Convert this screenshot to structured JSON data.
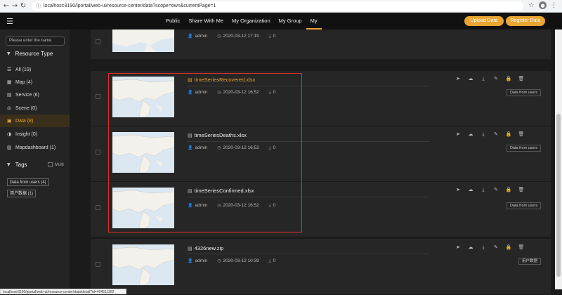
{
  "browser": {
    "url": "localhost:8190/iportal/web-ui/resource-center/data?scope=own&currentPage=1",
    "status_url": "localhost:8190/iportal/web-ui/resource-center/data/detail?id=404511392"
  },
  "topnav": {
    "tabs": [
      {
        "label": "Public"
      },
      {
        "label": "Share With Me"
      },
      {
        "label": "My Organization"
      },
      {
        "label": "My Group"
      },
      {
        "label": "My"
      }
    ],
    "upload_label": "Upload Data",
    "register_label": "Register Data"
  },
  "sidebar": {
    "search_placeholder": "Please enter the name",
    "resource_title": "Resource Type",
    "items": [
      {
        "label": "All (19)",
        "icon": "list-icon"
      },
      {
        "label": "Map (4)",
        "icon": "map-icon"
      },
      {
        "label": "Service (6)",
        "icon": "service-icon"
      },
      {
        "label": "Scene (0)",
        "icon": "scene-icon"
      },
      {
        "label": "Data (8)",
        "icon": "data-icon"
      },
      {
        "label": "Insight (0)",
        "icon": "insight-icon"
      },
      {
        "label": "Mapdashboard (1)",
        "icon": "dashboard-icon"
      }
    ],
    "tags_title": "Tags",
    "multi_label": "Multi",
    "tags": [
      {
        "label": "Data from users (4)"
      },
      {
        "label": "用户数据 (1)"
      }
    ]
  },
  "cards": [
    {
      "name": "",
      "user": "admin",
      "date": "2020-03-12 17:19",
      "downloads": "0",
      "tag": ""
    },
    {
      "name": "timeSeriesRecovered.xlsx",
      "user": "admin",
      "date": "2020-03-12 16:52",
      "downloads": "0",
      "tag": "Data from users"
    },
    {
      "name": "timeSeriesDeaths.xlsx",
      "user": "admin",
      "date": "2020-03-12 16:52",
      "downloads": "0",
      "tag": "Data from users"
    },
    {
      "name": "timeSeriesConfirmed.xlsx",
      "user": "admin",
      "date": "2020-03-12 16:52",
      "downloads": "0",
      "tag": "Data from users"
    },
    {
      "name": "4326new.zip",
      "user": "admin",
      "date": "2020-03-12 10:39",
      "downloads": "0",
      "tag": "用户数据"
    }
  ],
  "colors": {
    "accent": "#e9a531",
    "highlight": "#e0302a"
  }
}
